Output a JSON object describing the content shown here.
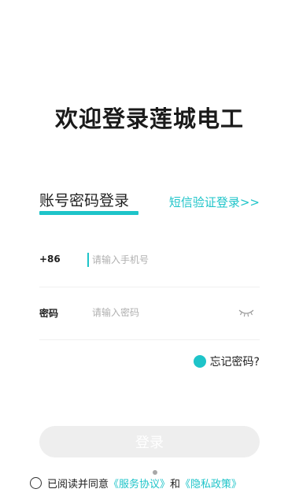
{
  "page": {
    "title": "欢迎登录莲城电工"
  },
  "tabs": {
    "active_label": "账号密码登录",
    "sms_label": "短信验证登录>>"
  },
  "phone": {
    "prefix": "+86",
    "value": "",
    "placeholder": "请输入手机号"
  },
  "password": {
    "label": "密码",
    "value": "",
    "placeholder": "请输入密码",
    "toggle_icon": "eye-closed-icon"
  },
  "forgot": {
    "label": "忘记密码?",
    "icon": "dot-icon"
  },
  "login": {
    "label": "登录"
  },
  "agreement": {
    "prefix": "已阅读并同意",
    "service_link": "《服务协议》",
    "conjunction": "和",
    "privacy_link": "《隐私政策》",
    "checked": false
  },
  "colors": {
    "accent": "#1ec4c9",
    "button_disabled": "#eeeeee",
    "placeholder": "#b0b0b0"
  }
}
